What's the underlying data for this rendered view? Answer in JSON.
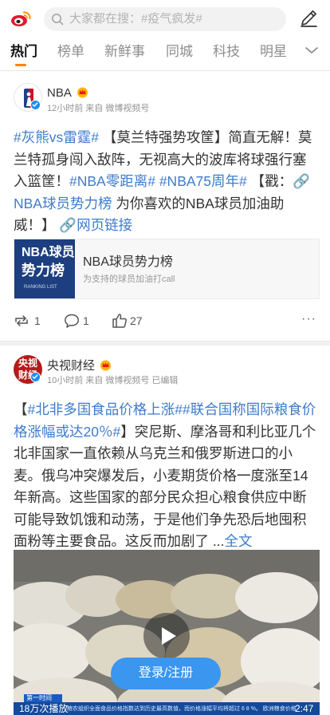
{
  "search": {
    "placeholder": "大家都在搜：#疫气疯发#"
  },
  "tabs": [
    "热门",
    "榜单",
    "新鲜事",
    "同城",
    "科技",
    "明星"
  ],
  "colors": {
    "accent": "#ff8200",
    "link": "#3e7bcb",
    "verified": "#1c8ff0",
    "login": "#3a96ef"
  },
  "posts": [
    {
      "author": "NBA",
      "meta": "12小时前 来自 微博视频号",
      "text": {
        "t1": "#灰熊vs雷霆#",
        "t2": " 【莫兰特强势攻筐】简直无解！莫兰特孤身闯入敌阵，无视高大的波库将球强行塞入篮筐！",
        "t3": "#NBA零距离#",
        "t4": " ",
        "t5": "#NBA75周年#",
        "t6": " 【戳：",
        "t7": "NBA球员势力榜",
        "t8": " 为你喜欢的NBA球员加油助威！】 ",
        "t9": "网页链接"
      },
      "card": {
        "thumb_line1": "NBA球员",
        "thumb_line2": "势力榜",
        "thumb_line3": "RANKING LIST",
        "title": "NBA球员势力榜",
        "subtitle": "为支持的球员加油打call"
      },
      "actions": {
        "reposts": "1",
        "comments": "1",
        "likes": "27"
      }
    },
    {
      "author": "央视财经",
      "avatar_text": "央视\n财经",
      "meta": "10小时前 来自 微博视频号 已编辑",
      "text": {
        "t1": "【",
        "t2": "#北非多国食品价格上涨#",
        "t3": "#联合国称国际粮食价格涨幅或达20％#",
        "t4": "】突尼斯、摩洛哥和利比亚几个北非国家一直依赖从乌克兰和俄罗斯进口的小麦。俄乌冲突爆发后，小麦期货价格一度涨至14年新高。这些国家的部分民众担心粮食供应中断可能导致饥饿和动荡，于是他们争先恐后地囤积面粉等主要食品。这反而加剧了 ...",
        "t5": "全文"
      },
      "video": {
        "views": "18万次播放",
        "duration": "2:47",
        "banner": "第一时间",
        "ticker": "粮农组织全面食品价格指数达到历史最高数值，而价格涨幅平均将超过 6 8 %。  欧洲粮食价格"
      }
    }
  ],
  "login_button": "登录/注册"
}
